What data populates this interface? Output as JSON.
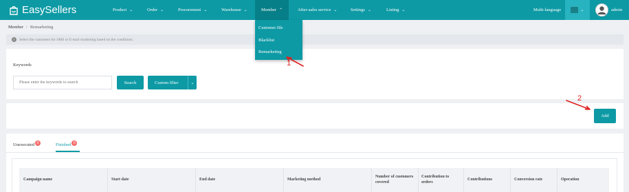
{
  "app": {
    "logo_text": "EasySellers"
  },
  "nav": {
    "items": [
      {
        "label": "Product",
        "active": false
      },
      {
        "label": "Order",
        "active": false
      },
      {
        "label": "Procurement",
        "active": false
      },
      {
        "label": "Warehouse",
        "active": false
      },
      {
        "label": "Member",
        "active": true
      },
      {
        "label": "After-sales service",
        "active": false
      },
      {
        "label": "Settings",
        "active": false
      },
      {
        "label": "Listing",
        "active": false
      }
    ],
    "multi_language": "Multi-language",
    "user": "admin"
  },
  "dropdown": {
    "items": [
      "Customer file",
      "Blacklist",
      "Remarketing"
    ]
  },
  "annotations": {
    "one": "1",
    "two": "2"
  },
  "breadcrumb": {
    "parent": "Member",
    "separator": "/",
    "current": "Remarketing"
  },
  "info": {
    "text": "Select the customers for SMS or E-mail marketing based on the conditions."
  },
  "filter": {
    "keywords_label": "Keywords",
    "keywords_placeholder": "Please enter the keywords to search",
    "search_button": "Search",
    "custom_filter_button": "Custom filter"
  },
  "actions": {
    "add_button": "Add"
  },
  "tabs": [
    {
      "label": "Unexecuted",
      "badge": "0",
      "active": false
    },
    {
      "label": "Finished",
      "badge": "0",
      "active": true
    }
  ],
  "table": {
    "columns": [
      "Campaign name",
      "Start date",
      "End date",
      "Marketing method",
      "Number of customers covered",
      "Contribution to orders",
      "Contributions",
      "Conversion rate",
      "Operation"
    ]
  },
  "colors": {
    "brand": "#0d9aa5",
    "brand_dark": "#077f88",
    "badge": "#f56c6c",
    "annotation": "#e02020"
  }
}
